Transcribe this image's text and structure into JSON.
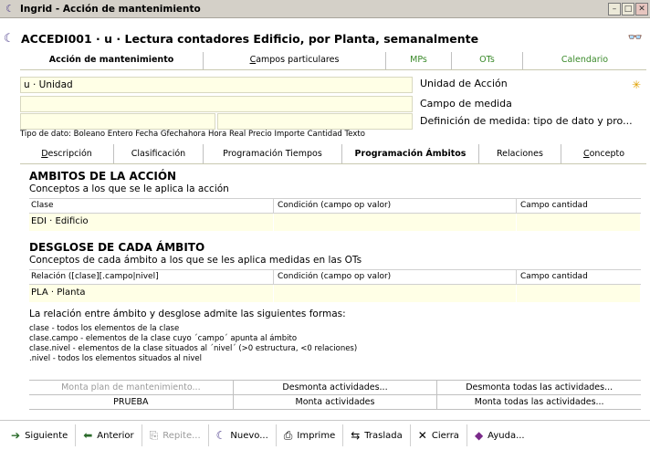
{
  "window": {
    "title": "Ingrid - Acción de mantenimiento",
    "controls": [
      "–",
      "□",
      "✕"
    ]
  },
  "header": {
    "title": "ACCEDI001 · u · Lectura contadores Edificio, por Planta, semanalmente"
  },
  "tabs_top": [
    {
      "label": "Acción de mantenimiento",
      "active": true
    },
    {
      "label": "Campos particulares"
    },
    {
      "label": "MPs",
      "color": "#3a8a2a"
    },
    {
      "label": "OTs",
      "color": "#3a8a2a"
    },
    {
      "label": "Calendario",
      "color": "#3a8a2a"
    }
  ],
  "fields": {
    "unit_value": "u · Unidad",
    "unit_label": "Unidad de Acción",
    "campo_medida_label": "Campo de medida",
    "definicion_label": "Definición de medida: tipo de dato y pro..."
  },
  "tipos_dato": "Tipo de dato: Boleano Entero Fecha Gfechahora Hora Real Precio Importe Cantidad Texto",
  "tabs_bottom": [
    {
      "label": "Descripción"
    },
    {
      "label": "Clasificación"
    },
    {
      "label": "Programación Tiempos"
    },
    {
      "label": "Programación Ámbitos",
      "active": true
    },
    {
      "label": "Relaciones"
    },
    {
      "label": "Concepto"
    }
  ],
  "ambitos": {
    "title": "AMBITOS DE LA ACCIÓN",
    "subtitle": "Conceptos a los que se le aplica la acción",
    "headers": [
      "Clase",
      "Condición (campo op valor)",
      "Campo cantidad"
    ],
    "row": [
      "EDI · Edificio",
      "",
      ""
    ]
  },
  "desglose": {
    "title": "DESGLOSE DE CADA ÁMBITO",
    "subtitle": "Conceptos de cada ámbito a los que se les aplica medidas en las OTs",
    "headers": [
      "Relación ([clase][.campo|nivel]",
      "Condición (campo op valor)",
      "Campo cantidad"
    ],
    "row": [
      "PLA · Planta",
      "",
      ""
    ]
  },
  "explanation": {
    "intro": "La relación entre ámbito y desglose admite las siguientes formas:",
    "lines": [
      "clase - todos los elementos de la clase",
      "clase.campo - elementos de la clase cuyo ´campo´ apunta al ámbito",
      "clase.nivel - elementos de la clase situados al ´nivel´ (>0 estructura, <0 relaciones)",
      ".nivel - todos los elementos situados al nivel"
    ]
  },
  "actions": {
    "monta_plan": "Monta plan de mantenimiento...",
    "desmonta": "Desmonta actividades...",
    "desmonta_todas": "Desmonta todas las actividades...",
    "prueba": "PRUEBA",
    "monta": "Monta actividades",
    "monta_todas": "Monta todas las actividades..."
  },
  "toolbar": {
    "siguiente": "Siguiente",
    "anterior": "Anterior",
    "repite": "Repite...",
    "nuevo": "Nuevo...",
    "imprime": "Imprime",
    "traslada": "Traslada",
    "cierra": "Cierra",
    "ayuda": "Ayuda..."
  }
}
